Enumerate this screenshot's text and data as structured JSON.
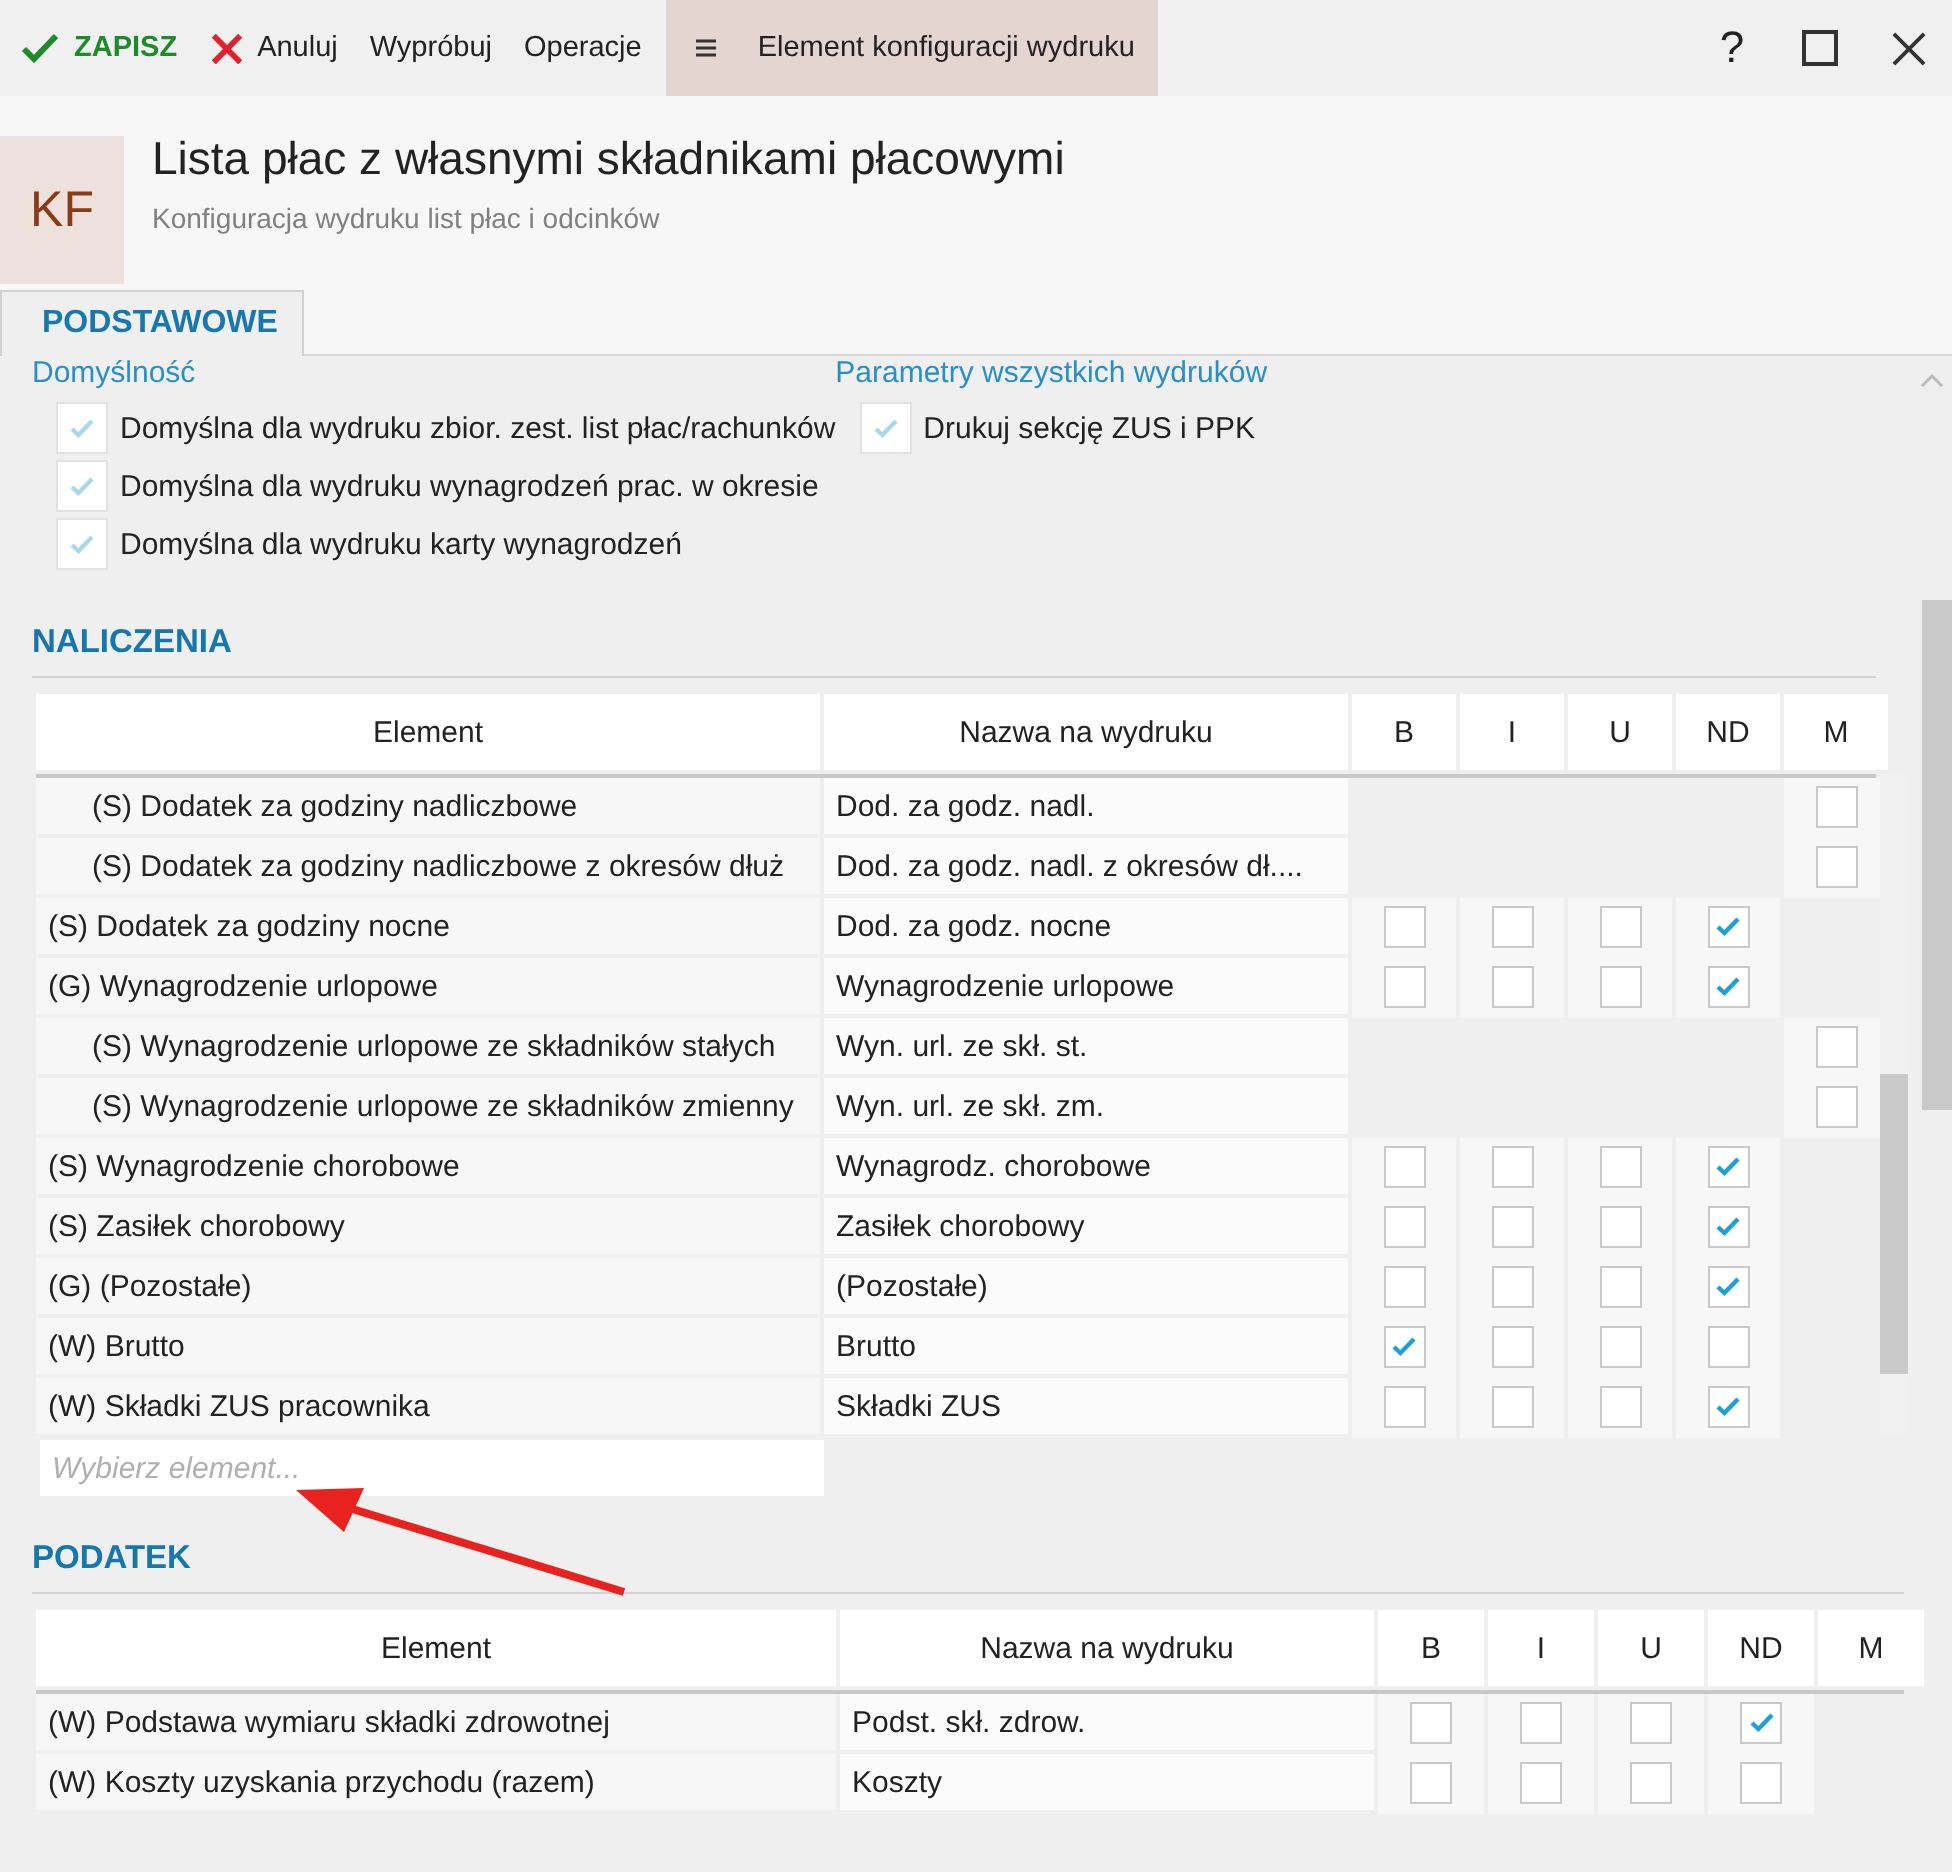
{
  "toolbar": {
    "buttons": [
      {
        "kind": "save",
        "label": "ZAPISZ"
      },
      {
        "kind": "cancel",
        "label": "Anuluj"
      },
      {
        "kind": "plain",
        "label": "Wypróbuj"
      },
      {
        "kind": "plain",
        "label": "Operacje"
      },
      {
        "kind": "menu",
        "label": "Element konfiguracji wydruku"
      }
    ],
    "help": "?"
  },
  "header": {
    "badge": "KF",
    "title": "Lista płac z własnymi składnikami płacowymi",
    "subtitle": "Konfiguracja wydruku list płac i odcinków"
  },
  "tabs": [
    {
      "label": "PODSTAWOWE",
      "selected": true
    }
  ],
  "groups": [
    {
      "title": "Domyślność",
      "options": [
        {
          "label": "Domyślna dla wydruku zbior. zest. list płac/rachunków",
          "checked": true
        },
        {
          "label": "Domyślna dla wydruku wynagrodzeń prac. w okresie",
          "checked": true
        },
        {
          "label": "Domyślna dla wydruku karty wynagrodzeń",
          "checked": true
        }
      ]
    },
    {
      "title": "Parametry wszystkich wydruków",
      "options": [
        {
          "label": "Drukuj sekcję ZUS i PPK",
          "checked": true
        }
      ]
    }
  ],
  "sections": [
    {
      "title": "NALICZENIA",
      "columns": [
        "Element",
        "Nazwa na wydruku",
        "B",
        "I",
        "U",
        "ND",
        "M"
      ],
      "placeholder": "Wybierz element...",
      "rows": [
        {
          "kind": "sub",
          "element": "(S) Dodatek za godziny nadliczbowe",
          "name": "Dod. za godz. nadl.",
          "m": false
        },
        {
          "kind": "sub",
          "element": "(S) Dodatek za godziny nadliczbowe z okresów dłuż",
          "name": "Dod. za godz. nadl. z okresów dł....",
          "m": false
        },
        {
          "kind": "item",
          "element": "(S) Dodatek za godziny nocne",
          "name": "Dod. za godz. nocne",
          "b": false,
          "i": false,
          "u": false,
          "nd": true
        },
        {
          "kind": "item",
          "element": "(G) Wynagrodzenie urlopowe",
          "name": "Wynagrodzenie urlopowe",
          "b": false,
          "i": false,
          "u": false,
          "nd": true,
          "children": [
            {
              "kind": "sub",
              "element": "(S) Wynagrodzenie urlopowe ze składników stałych",
              "name": "Wyn. url. ze skł. st.",
              "m": false
            },
            {
              "kind": "sub",
              "element": "(S) Wynagrodzenie urlopowe ze składników zmienny",
              "name": "Wyn. url. ze skł. zm.",
              "m": false
            }
          ]
        },
        {
          "kind": "item",
          "element": "(S) Wynagrodzenie chorobowe",
          "name": "Wynagrodz. chorobowe",
          "b": false,
          "i": false,
          "u": false,
          "nd": true
        },
        {
          "kind": "item",
          "element": "(S) Zasiłek chorobowy",
          "name": "Zasiłek chorobowy",
          "b": false,
          "i": false,
          "u": false,
          "nd": true
        },
        {
          "kind": "item",
          "element": "(G) (Pozostałe)",
          "name": "(Pozostałe)",
          "b": false,
          "i": false,
          "u": false,
          "nd": true
        },
        {
          "kind": "item",
          "element": "(W) Brutto",
          "name": "Brutto",
          "b": true,
          "i": false,
          "u": false,
          "nd": false
        },
        {
          "kind": "item",
          "element": "(W) Składki ZUS pracownika",
          "name": "Składki ZUS",
          "b": false,
          "i": false,
          "u": false,
          "nd": true
        }
      ]
    },
    {
      "title": "PODATEK",
      "columns": [
        "Element",
        "Nazwa na wydruku",
        "B",
        "I",
        "U",
        "ND",
        "M"
      ],
      "rows": [
        {
          "kind": "item",
          "element": "(W) Podstawa wymiaru składki zdrowotnej",
          "name": "Podst. skł. zdrow.",
          "b": false,
          "i": false,
          "u": false,
          "nd": true
        },
        {
          "kind": "item",
          "element": "(W) Koszty uzyskania przychodu (razem)",
          "name": "Koszty",
          "b": false,
          "i": false,
          "u": false,
          "nd": false
        }
      ]
    }
  ]
}
